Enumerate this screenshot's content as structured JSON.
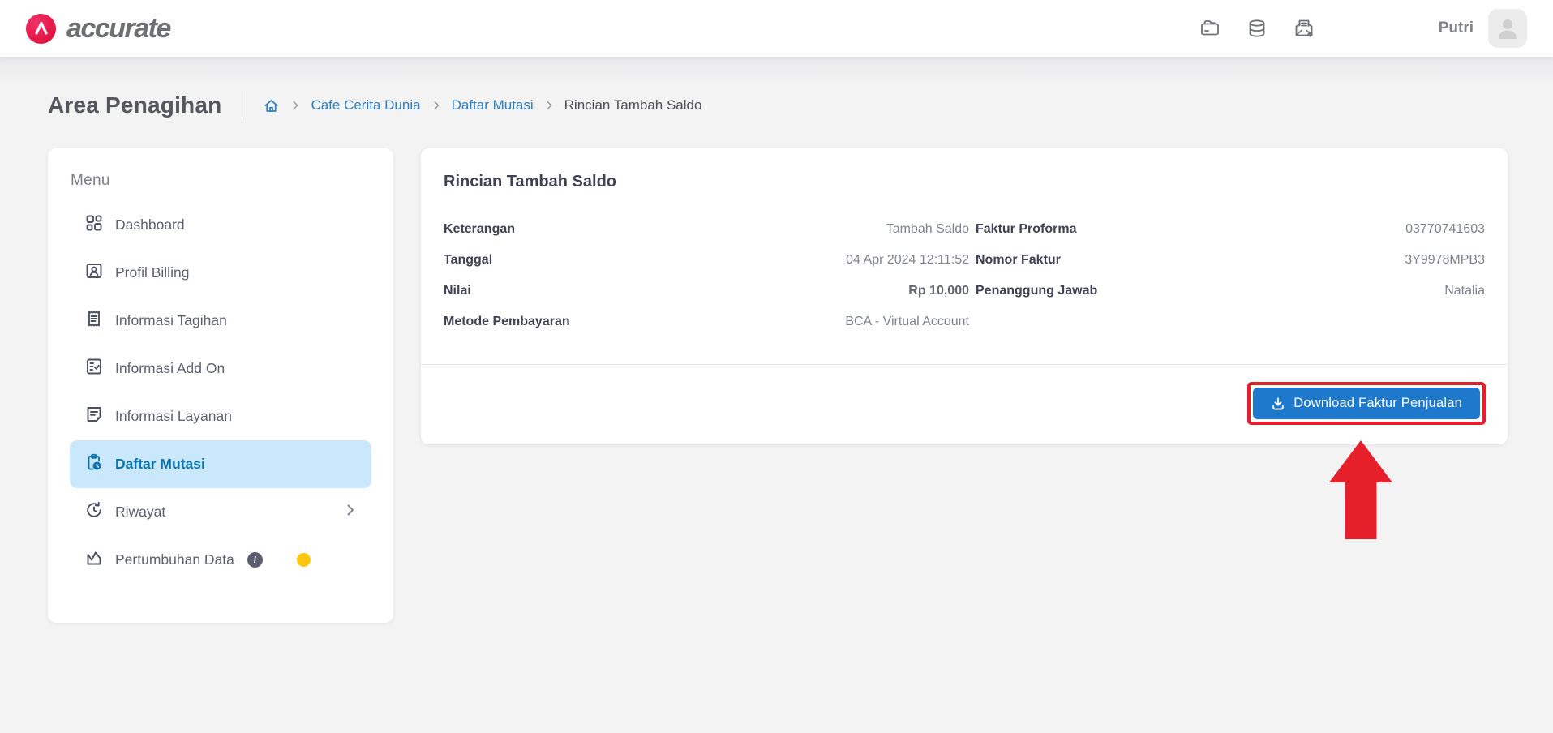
{
  "header": {
    "logo_text": "accurate",
    "user_name": "Putri",
    "icons": [
      "archive-drawer-icon",
      "database-icon",
      "send-invoice-icon"
    ]
  },
  "page": {
    "title": "Area Penagihan",
    "breadcrumb": [
      {
        "label": "Cafe Cerita Dunia",
        "type": "link"
      },
      {
        "label": "Daftar Mutasi",
        "type": "link"
      },
      {
        "label": "Rincian Tambah Saldo",
        "type": "current"
      }
    ]
  },
  "sidebar": {
    "heading": "Menu",
    "items": [
      {
        "label": "Dashboard",
        "icon": "dashboard-icon",
        "active": false
      },
      {
        "label": "Profil Billing",
        "icon": "profile-card-icon",
        "active": false
      },
      {
        "label": "Informasi Tagihan",
        "icon": "receipt-icon",
        "active": false
      },
      {
        "label": "Informasi Add On",
        "icon": "list-check-icon",
        "active": false
      },
      {
        "label": "Informasi Layanan",
        "icon": "note-icon",
        "active": false
      },
      {
        "label": "Daftar Mutasi",
        "icon": "clipboard-clock-icon",
        "active": true
      },
      {
        "label": "Riwayat",
        "icon": "history-icon",
        "active": false,
        "has_chevron": true
      },
      {
        "label": "Pertumbuhan Data",
        "icon": "growth-chart-icon",
        "active": false,
        "has_info": true,
        "has_yellow_dot": true
      }
    ]
  },
  "detail_card": {
    "title": "Rincian Tambah Saldo",
    "left_fields": [
      {
        "label": "Keterangan",
        "value": "Tambah Saldo"
      },
      {
        "label": "Tanggal",
        "value": "04 Apr 2024 12:11:52"
      },
      {
        "label": "Nilai",
        "value": "Rp 10,000"
      },
      {
        "label": "Metode Pembayaran",
        "value": "BCA - Virtual Account"
      }
    ],
    "right_fields": [
      {
        "label": "Faktur Proforma",
        "value": "03770741603"
      },
      {
        "label": "Nomor Faktur",
        "value": "3Y9978MPB3"
      },
      {
        "label": "Penanggung Jawab",
        "value": "Natalia"
      }
    ],
    "download_button": {
      "label": "Download Faktur Penjualan",
      "icon": "download-icon"
    }
  },
  "annotations": {
    "highlight_shape": "red rectangle around download button",
    "arrow_shape": "red up arrow pointing at download button"
  },
  "colors": {
    "accent_blue": "#1e78cb",
    "link_blue": "#2e80c4",
    "active_item_bg": "#c9e8fb",
    "active_item_text": "#0e74ad",
    "highlight_red": "#e5202a",
    "logo_red": "#e21441",
    "yellow_badge": "#fec70c",
    "page_bg": "#f3f3f4",
    "label_text": "#3f4254",
    "value_text": "#7e8390"
  }
}
